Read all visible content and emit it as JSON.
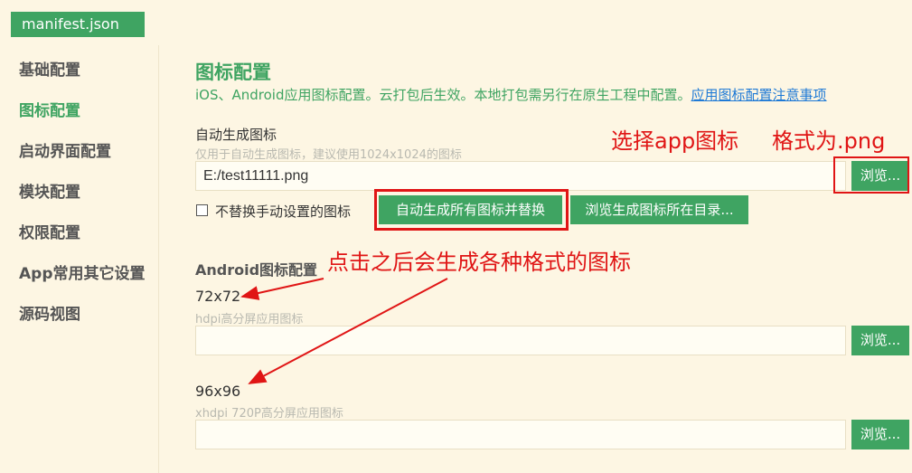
{
  "tab": {
    "label": "manifest.json"
  },
  "sidebar": {
    "items": [
      {
        "label": "基础配置",
        "active": false
      },
      {
        "label": "图标配置",
        "active": true
      },
      {
        "label": "启动界面配置",
        "active": false
      },
      {
        "label": "模块配置",
        "active": false
      },
      {
        "label": "权限配置",
        "active": false
      },
      {
        "label": "App常用其它设置",
        "active": false
      },
      {
        "label": "源码视图",
        "active": false
      }
    ]
  },
  "main": {
    "title": "图标配置",
    "description": "iOS、Android应用图标配置。云打包后生效。本地打包需另行在原生工程中配置。",
    "description_link": "应用图标配置注意事项",
    "auto_gen": {
      "label": "自动生成图标",
      "hint": "仅用于自动生成图标，建议使用1024x1024的图标",
      "value": "E:/test11111.png",
      "browse_label": "浏览...",
      "checkbox_label": "不替换手动设置的图标",
      "checkbox_checked": false,
      "generate_label": "自动生成所有图标并替换",
      "open_dir_label": "浏览生成图标所在目录..."
    },
    "android": {
      "section_title": "Android图标配置",
      "icons": [
        {
          "size": "72x72",
          "hint": "hdpi高分屏应用图标",
          "value": "",
          "browse_label": "浏览..."
        },
        {
          "size": "96x96",
          "hint": "xhdpi 720P高分屏应用图标",
          "value": "",
          "browse_label": "浏览..."
        }
      ]
    }
  },
  "annotations": {
    "select_icon": "选择app图标",
    "format": "格式为.png",
    "after_click": "点击之后会生成各种格式的图标",
    "color": "#e01515"
  },
  "colors": {
    "accent": "#3fa462",
    "background": "#fdf6e3",
    "link": "#1f7ad6"
  }
}
